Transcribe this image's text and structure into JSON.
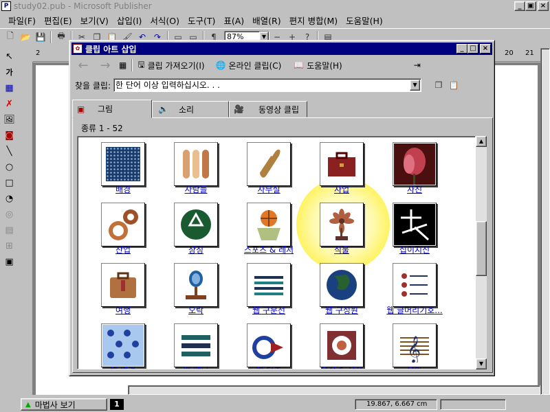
{
  "window": {
    "title": "study02.pub - Microsoft Publisher",
    "icon": "publisher-icon"
  },
  "menu": [
    "파일(F)",
    "편집(E)",
    "보기(V)",
    "삽입(I)",
    "서식(O)",
    "도구(T)",
    "표(A)",
    "배열(R)",
    "편지 병합(M)",
    "도움말(H)"
  ],
  "toolbar": {
    "zoom": "87%"
  },
  "ruler": {
    "left_label": "2",
    "right_labels": [
      "20",
      "21"
    ]
  },
  "dialog": {
    "title": "클립 아트 삽입",
    "toolbar": {
      "back_icon": "back-arrow-icon",
      "forward_icon": "forward-arrow-icon",
      "import": "클립 가져오기(I)",
      "online": "온라인 클립(C)",
      "help": "도움말(H)"
    },
    "search_label": "찾을 클립:",
    "search_value": "한 단어 이상 입력하십시오. . .",
    "tabs": [
      "그림",
      "소리",
      "동영상 클립"
    ],
    "count": "종류 1 - 52",
    "categories": [
      "배경",
      "사람들",
      "사무실",
      "사업",
      "사진",
      "산업",
      "상징",
      "스포츠 & 레저",
      "식물",
      "십이지신",
      "여행",
      "오락",
      "웹 구분선",
      "웹 구성원",
      "웹 글머리기호...",
      "웹 배경",
      "웹 배너",
      "웹 단추",
      "음식 & 식사",
      "음악"
    ]
  },
  "status": {
    "wizard": "마법사 보기",
    "page": "1",
    "coords": "19.867, 6.667 cm"
  }
}
